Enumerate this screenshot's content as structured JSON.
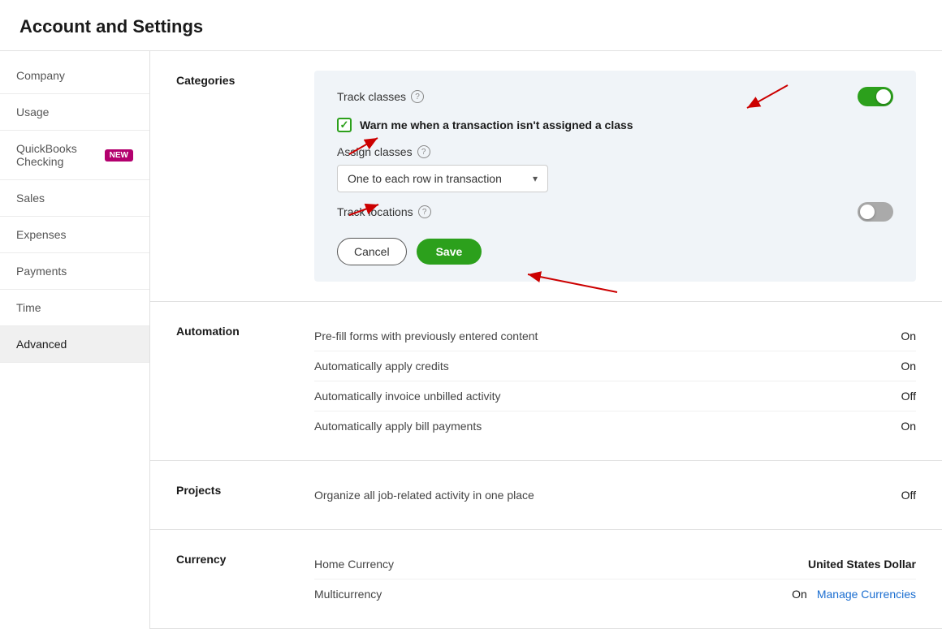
{
  "page": {
    "title": "Account and Settings"
  },
  "sidebar": {
    "items": [
      {
        "id": "company",
        "label": "Company",
        "active": false,
        "badge": null
      },
      {
        "id": "usage",
        "label": "Usage",
        "active": false,
        "badge": null
      },
      {
        "id": "quickbooks-checking",
        "label": "QuickBooks Checking",
        "active": false,
        "badge": "NEW"
      },
      {
        "id": "sales",
        "label": "Sales",
        "active": false,
        "badge": null
      },
      {
        "id": "expenses",
        "label": "Expenses",
        "active": false,
        "badge": null
      },
      {
        "id": "payments",
        "label": "Payments",
        "active": false,
        "badge": null
      },
      {
        "id": "time",
        "label": "Time",
        "active": false,
        "badge": null
      },
      {
        "id": "advanced",
        "label": "Advanced",
        "active": true,
        "badge": null
      }
    ]
  },
  "categories": {
    "section_label": "Categories",
    "track_classes_label": "Track classes",
    "track_classes_toggle": "on",
    "warn_checkbox_label": "Warn me when a transaction isn't assigned a class",
    "warn_checkbox_checked": true,
    "assign_classes_label": "Assign classes",
    "assign_classes_value": "One to each row in transaction",
    "track_locations_label": "Track locations",
    "track_locations_toggle": "off",
    "cancel_label": "Cancel",
    "save_label": "Save"
  },
  "automation": {
    "section_label": "Automation",
    "rows": [
      {
        "label": "Pre-fill forms with previously entered content",
        "value": "On"
      },
      {
        "label": "Automatically apply credits",
        "value": "On"
      },
      {
        "label": "Automatically invoice unbilled activity",
        "value": "Off"
      },
      {
        "label": "Automatically apply bill payments",
        "value": "On"
      }
    ]
  },
  "projects": {
    "section_label": "Projects",
    "rows": [
      {
        "label": "Organize all job-related activity in one place",
        "value": "Off"
      }
    ]
  },
  "currency": {
    "section_label": "Currency",
    "rows": [
      {
        "label": "Home Currency",
        "value": "United States Dollar",
        "value_bold": true
      },
      {
        "label": "Multicurrency",
        "value": "On",
        "link_label": "Manage Currencies"
      }
    ]
  },
  "icons": {
    "help": "?",
    "chevron_down": "▾",
    "check": "✓"
  }
}
